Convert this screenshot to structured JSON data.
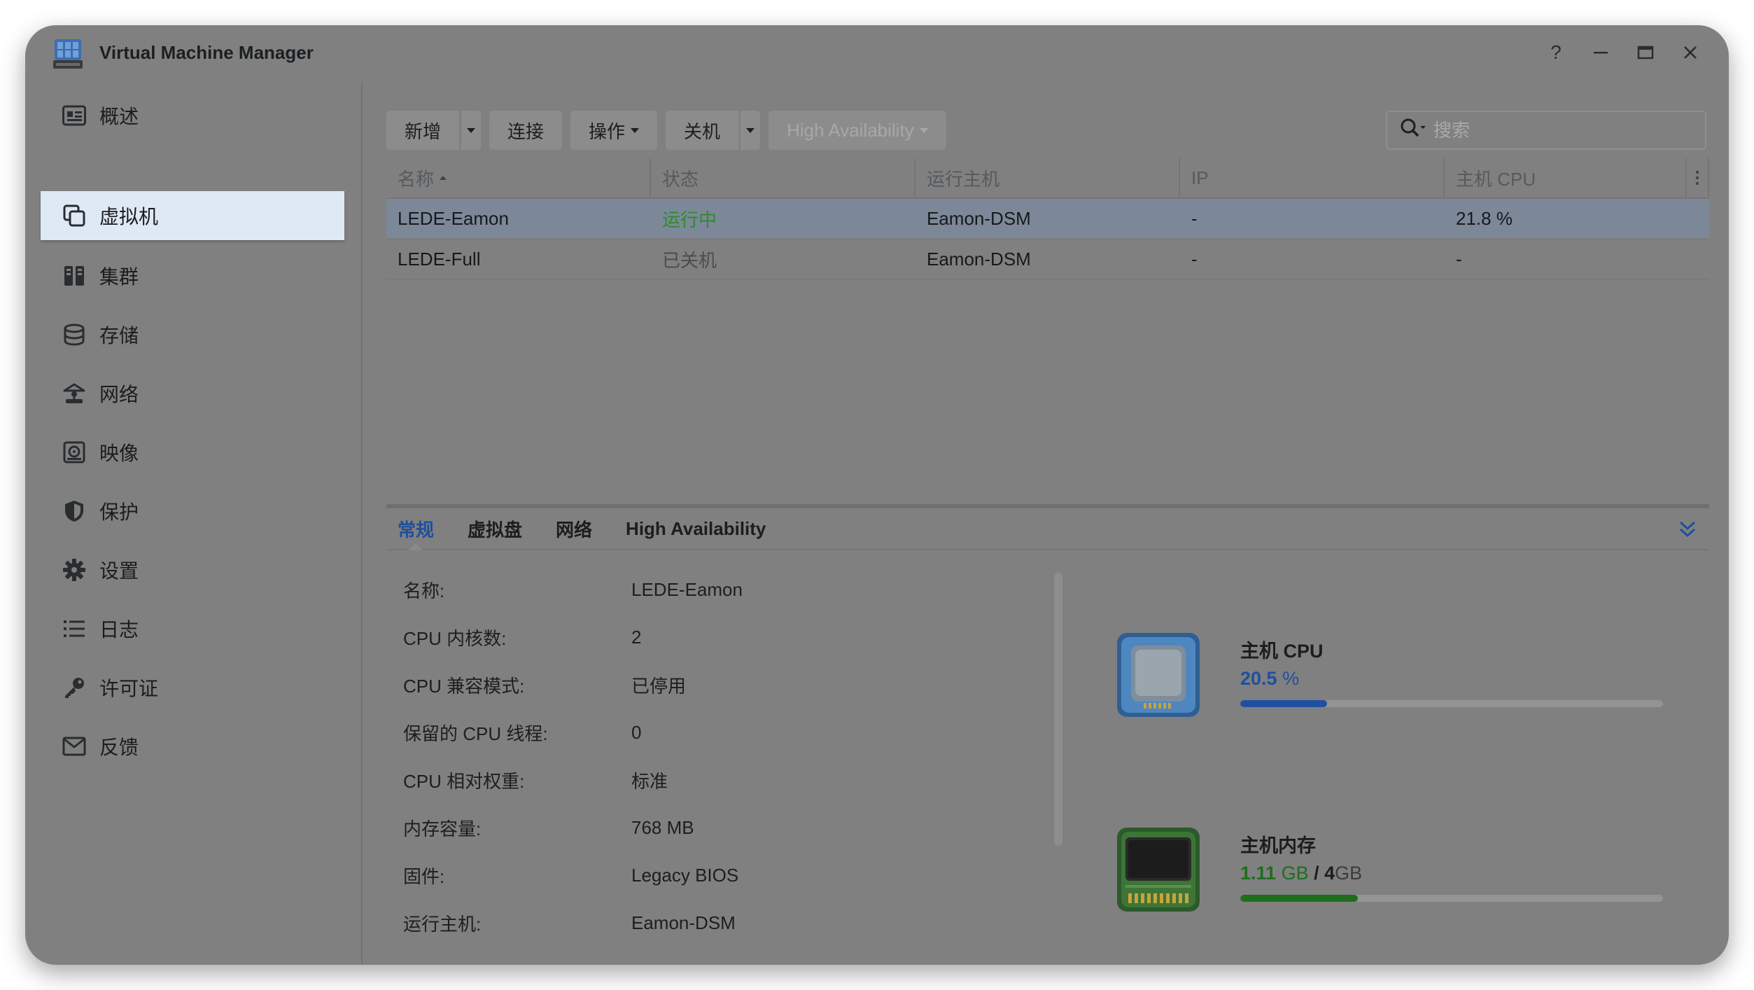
{
  "app": {
    "title": "Virtual Machine Manager"
  },
  "window_controls": {
    "help": "?",
    "minimize": "—",
    "maximize": "▭",
    "close": "✕"
  },
  "sidebar": {
    "items": [
      {
        "label": "概述",
        "icon": "overview-icon"
      },
      {
        "label": "虚拟机",
        "icon": "virtual-machine-icon",
        "active": true
      },
      {
        "label": "集群",
        "icon": "cluster-icon"
      },
      {
        "label": "存储",
        "icon": "storage-icon"
      },
      {
        "label": "网络",
        "icon": "network-icon"
      },
      {
        "label": "映像",
        "icon": "image-icon"
      },
      {
        "label": "保护",
        "icon": "shield-icon"
      },
      {
        "label": "设置",
        "icon": "gear-icon"
      },
      {
        "label": "日志",
        "icon": "log-icon"
      },
      {
        "label": "许可证",
        "icon": "key-icon"
      },
      {
        "label": "反馈",
        "icon": "mail-icon"
      }
    ]
  },
  "toolbar": {
    "new_label": "新增",
    "connect_label": "连接",
    "action_label": "操作",
    "shutdown_label": "关机",
    "ha_label": "High Availability"
  },
  "search": {
    "placeholder": "搜索",
    "value": ""
  },
  "table": {
    "columns": [
      "名称",
      "状态",
      "运行主机",
      "IP",
      "主机 CPU"
    ],
    "rows": [
      {
        "name": "LEDE-Eamon",
        "status": "运行中",
        "host": "Eamon-DSM",
        "ip": "-",
        "cpu": "21.8 %",
        "selected": true
      },
      {
        "name": "LEDE-Full",
        "status": "已关机",
        "host": "Eamon-DSM",
        "ip": "-",
        "cpu": "-"
      }
    ]
  },
  "detail_tabs": [
    "常规",
    "虚拟盘",
    "网络",
    "High Availability"
  ],
  "details": [
    {
      "label": "名称:",
      "value": "LEDE-Eamon"
    },
    {
      "label": "CPU 内核数:",
      "value": "2"
    },
    {
      "label": "CPU 兼容模式:",
      "value": "已停用"
    },
    {
      "label": "保留的 CPU 线程:",
      "value": "0"
    },
    {
      "label": "CPU 相对权重:",
      "value": "标准"
    },
    {
      "label": "内存容量:",
      "value": "768 MB"
    },
    {
      "label": "固件:",
      "value": "Legacy BIOS"
    },
    {
      "label": "运行主机:",
      "value": "Eamon-DSM"
    }
  ],
  "stats": {
    "cpu": {
      "title": "主机 CPU",
      "value": "20.5",
      "unit": "%",
      "fraction": 0.205,
      "color": "#1f4fa0"
    },
    "memory": {
      "title": "主机内存",
      "used": "1.11",
      "used_unit": "GB",
      "sep": "/",
      "total": "4",
      "total_unit": "GB",
      "fraction": 0.2775,
      "color": "#1e6e1e"
    }
  },
  "colors": {
    "accent": "#1f4f9c",
    "running": "#2e8a2e",
    "selected_row": "#7c8898"
  }
}
